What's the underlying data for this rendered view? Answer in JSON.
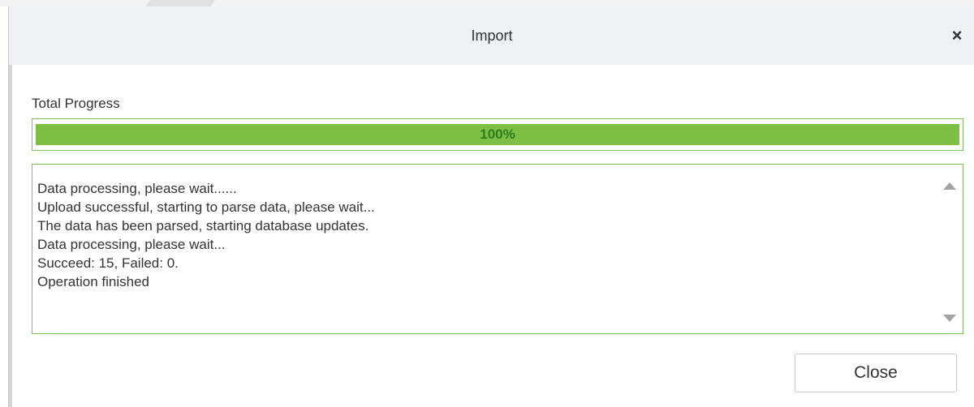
{
  "dialog": {
    "title": "Import",
    "close_symbol": "×"
  },
  "progress": {
    "label": "Total Progress",
    "percent": 100,
    "percent_text": "100%",
    "fill_color": "#7dbe45",
    "border_color": "#7cc05a"
  },
  "log": {
    "lines": [
      "Data processing, please wait......",
      "Upload successful, starting to parse data, please wait...",
      "The data has been parsed, starting database updates.",
      "Data processing, please wait...",
      "Succeed: 15, Failed: 0.",
      "Operation finished"
    ]
  },
  "footer": {
    "close_label": "Close"
  },
  "icons": {
    "close": "close-icon",
    "scroll_up": "scroll-up-arrow-icon",
    "scroll_down": "scroll-down-arrow-icon"
  }
}
